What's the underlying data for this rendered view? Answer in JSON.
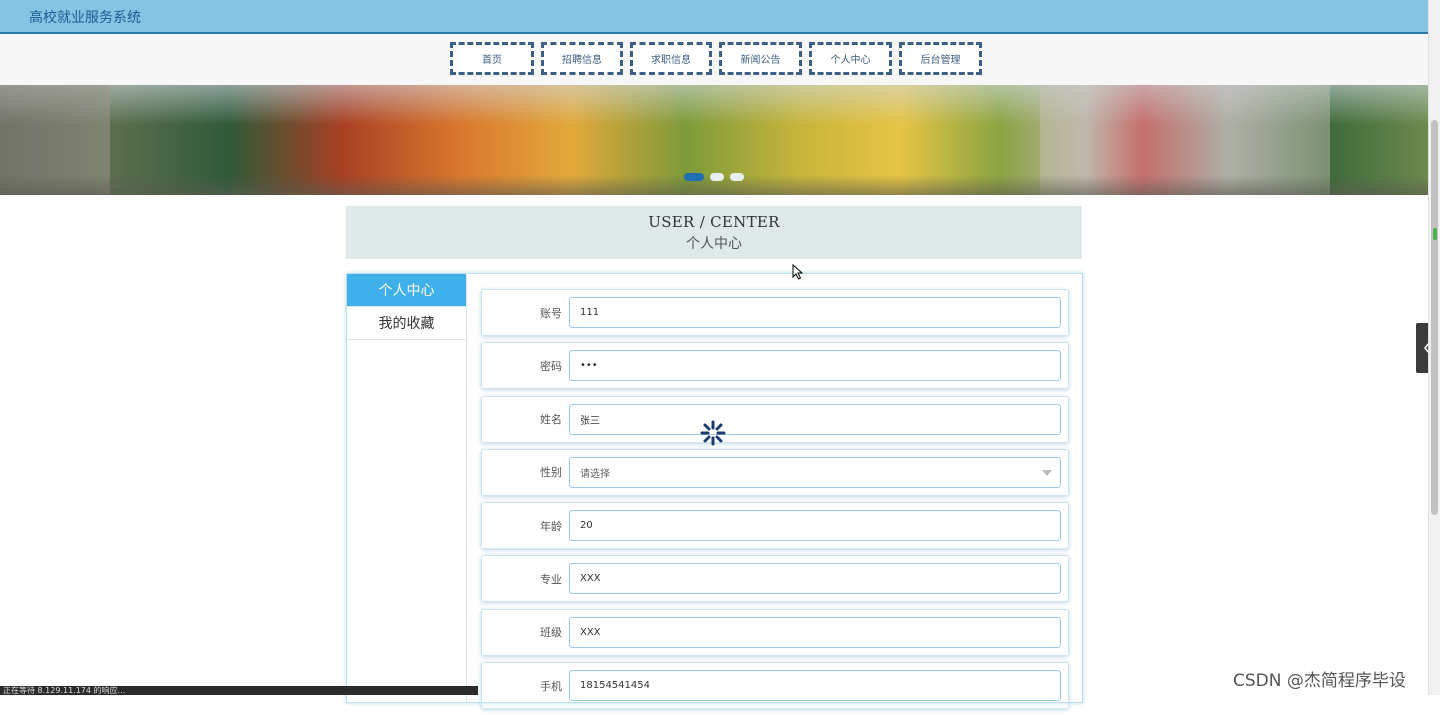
{
  "header": {
    "site_title": "高校就业服务系统"
  },
  "nav": {
    "items": [
      {
        "label": "首页"
      },
      {
        "label": "招聘信息"
      },
      {
        "label": "求职信息"
      },
      {
        "label": "新闻公告"
      },
      {
        "label": "个人中心"
      },
      {
        "label": "后台管理"
      }
    ]
  },
  "heading": {
    "en": "USER / CENTER",
    "zh": "个人中心"
  },
  "sidebar": {
    "items": [
      {
        "label": "个人中心",
        "active": true
      },
      {
        "label": "我的收藏",
        "active": false
      }
    ]
  },
  "form": {
    "fields": [
      {
        "label": "账号",
        "value": "111"
      },
      {
        "label": "密码",
        "value": "•••"
      },
      {
        "label": "姓名",
        "value": "张三"
      },
      {
        "label": "性别",
        "value": "请选择"
      },
      {
        "label": "年龄",
        "value": "20"
      },
      {
        "label": "专业",
        "value": "XXX"
      },
      {
        "label": "班级",
        "value": "XXX"
      },
      {
        "label": "手机",
        "value": "18154541454"
      }
    ]
  },
  "status_bar": {
    "text": "正在等待 8.129.11.174 的响应..."
  },
  "watermark": {
    "text": "CSDN @杰简程序毕设"
  },
  "colors": {
    "accent": "#3fb0e9",
    "header_bg": "#86c4e4",
    "nav_border": "#3e5f86",
    "active_dot": "#1f6fb2"
  }
}
